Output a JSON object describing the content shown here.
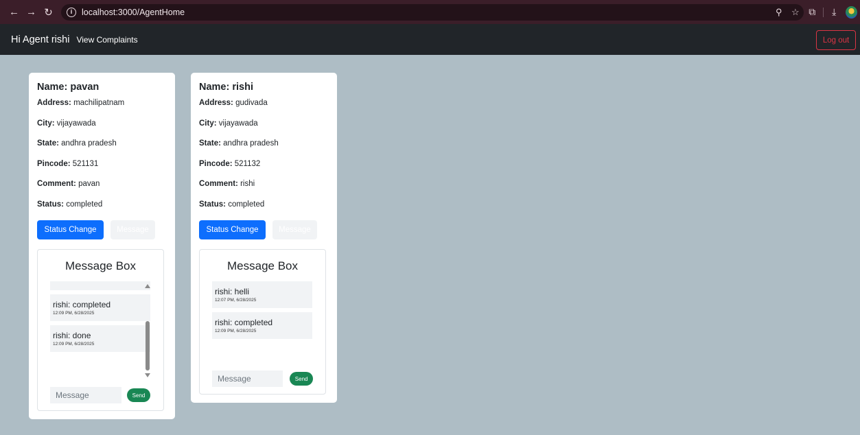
{
  "browser": {
    "url": "localhost:3000/AgentHome"
  },
  "navbar": {
    "brand": "Hi Agent rishi",
    "view_complaints": "View Complaints",
    "logout": "Log out"
  },
  "labels": {
    "name": "Name:",
    "address": "Address:",
    "city": "City:",
    "state": "State:",
    "pincode": "Pincode:",
    "comment": "Comment:",
    "status": "Status:",
    "status_change": "Status Change",
    "message": "Message",
    "message_box": "Message Box",
    "message_placeholder": "Message",
    "send": "Send"
  },
  "complaints": [
    {
      "name": "pavan",
      "address": "machilipatnam",
      "city": "vijayawada",
      "state": "andhra pradesh",
      "pincode": "521131",
      "comment": "pavan",
      "status": "completed",
      "messages": [
        {
          "text": "rishi: completed",
          "time": "12:09 PM, 6/28/2025"
        },
        {
          "text": "rishi: done",
          "time": "12:09 PM, 6/28/2025"
        }
      ]
    },
    {
      "name": "rishi",
      "address": "gudivada",
      "city": "vijayawada",
      "state": "andhra pradesh",
      "pincode": "521132",
      "comment": "rishi",
      "status": "completed",
      "messages": [
        {
          "text": "rishi: helli",
          "time": "12:07 PM, 6/28/2025"
        },
        {
          "text": "rishi: completed",
          "time": "12:09 PM, 6/28/2025"
        }
      ]
    }
  ]
}
